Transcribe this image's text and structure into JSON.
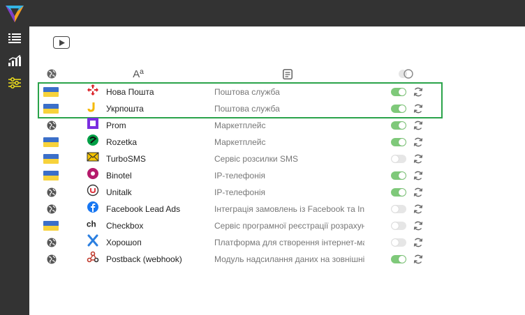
{
  "header_cols": {
    "name_icon": "Aª"
  },
  "colors": {
    "sidebar_bg": "#333333",
    "accent_yellow": "#f2e21c",
    "toggle_on": "#7fc97a",
    "toggle_off": "#e6e6e6",
    "highlight_border": "#2aa34a"
  },
  "rows": [
    {
      "region": "ua",
      "icon": "novaposhta-icon",
      "name": "Нова Пошта",
      "desc": "Поштова служба",
      "enabled": true
    },
    {
      "region": "ua",
      "icon": "ukrposhta-icon",
      "name": "Укрпошта",
      "desc": "Поштова служба",
      "enabled": true
    },
    {
      "region": "global",
      "icon": "prom-icon",
      "name": "Prom",
      "desc": "Маркетплейс",
      "enabled": true
    },
    {
      "region": "ua",
      "icon": "rozetka-icon",
      "name": "Rozetka",
      "desc": "Маркетплейс",
      "enabled": true
    },
    {
      "region": "ua",
      "icon": "turbosms-icon",
      "name": "TurboSMS",
      "desc": "Сервіс розсилки SMS",
      "enabled": false
    },
    {
      "region": "ua",
      "icon": "binotel-icon",
      "name": "Binotel",
      "desc": "IP-телефонія",
      "enabled": true
    },
    {
      "region": "global",
      "icon": "unitalk-icon",
      "name": "Unitalk",
      "desc": "IP-телефонія",
      "enabled": true
    },
    {
      "region": "global",
      "icon": "facebook-icon",
      "name": "Facebook Lead Ads",
      "desc": "Інтеграція замовлень із Facebook та In...",
      "enabled": false
    },
    {
      "region": "ua",
      "icon": "checkbox-icon",
      "name": "Checkbox",
      "desc": "Сервіс програмної реєстрації розрахун...",
      "enabled": false
    },
    {
      "region": "global",
      "icon": "horoshop-icon",
      "name": "Хорошоп",
      "desc": "Платформа для створення інтернет-ма...",
      "enabled": false
    },
    {
      "region": "global",
      "icon": "webhook-icon",
      "name": "Postback (webhook)",
      "desc": "Модуль надсилання даних на зовнішні...",
      "enabled": true
    }
  ]
}
